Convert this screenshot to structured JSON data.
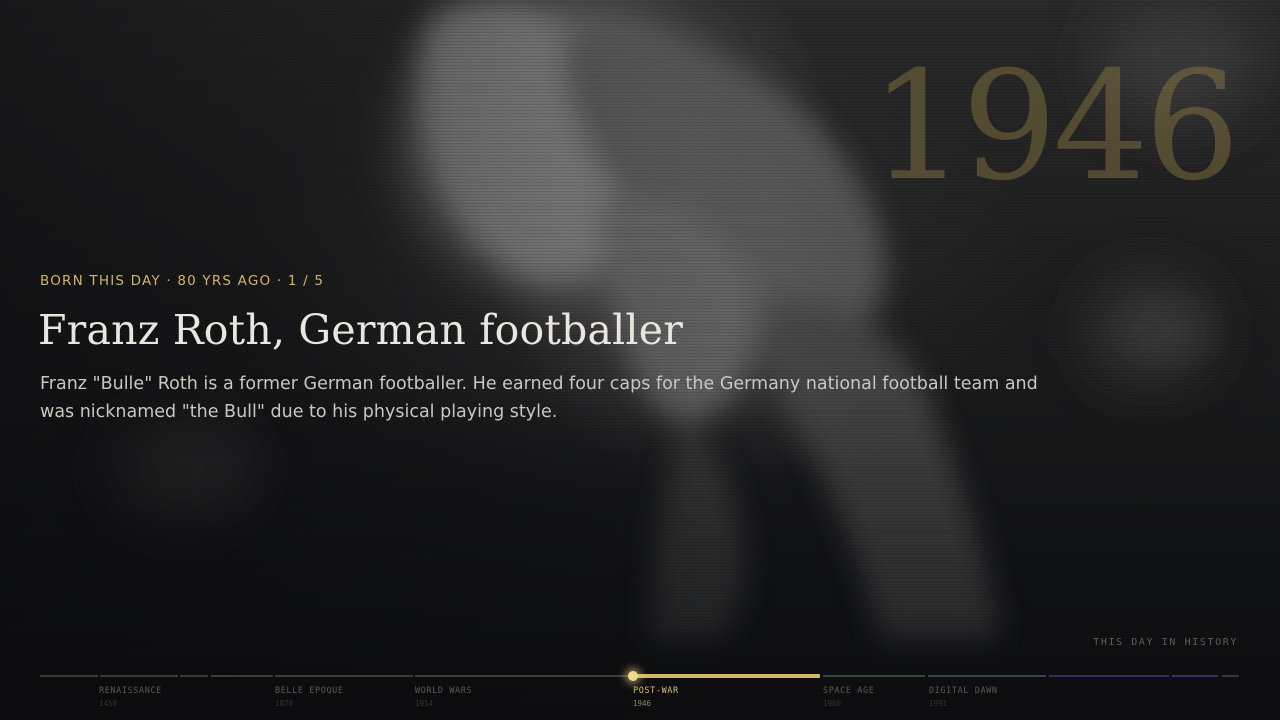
{
  "big_year": "1946",
  "kicker": "BORN THIS DAY · 80 YRS AGO · 1 / 5",
  "headline": "Franz Roth, German footballer",
  "summary": "Franz \"Bulle\" Roth is a former German footballer. He earned four caps for the Germany national football team and was nicknamed \"the Bull\" due to his physical playing style.",
  "brand": "THIS DAY IN HISTORY",
  "timeline": {
    "progress_percent": 59.5,
    "accent_color": "#d4b86a",
    "eras": [
      {
        "label": "RENAISSANCE",
        "year": "1450",
        "active": false
      },
      {
        "label": "BELLE EPOQUE",
        "year": "1870",
        "active": false
      },
      {
        "label": "WORLD WARS",
        "year": "1914",
        "active": false
      },
      {
        "label": "POST-WAR",
        "year": "1946",
        "active": true
      },
      {
        "label": "SPACE AGE",
        "year": "1960",
        "active": false
      },
      {
        "label": "DIGITAL DAWN",
        "year": "1991",
        "active": false
      }
    ]
  }
}
